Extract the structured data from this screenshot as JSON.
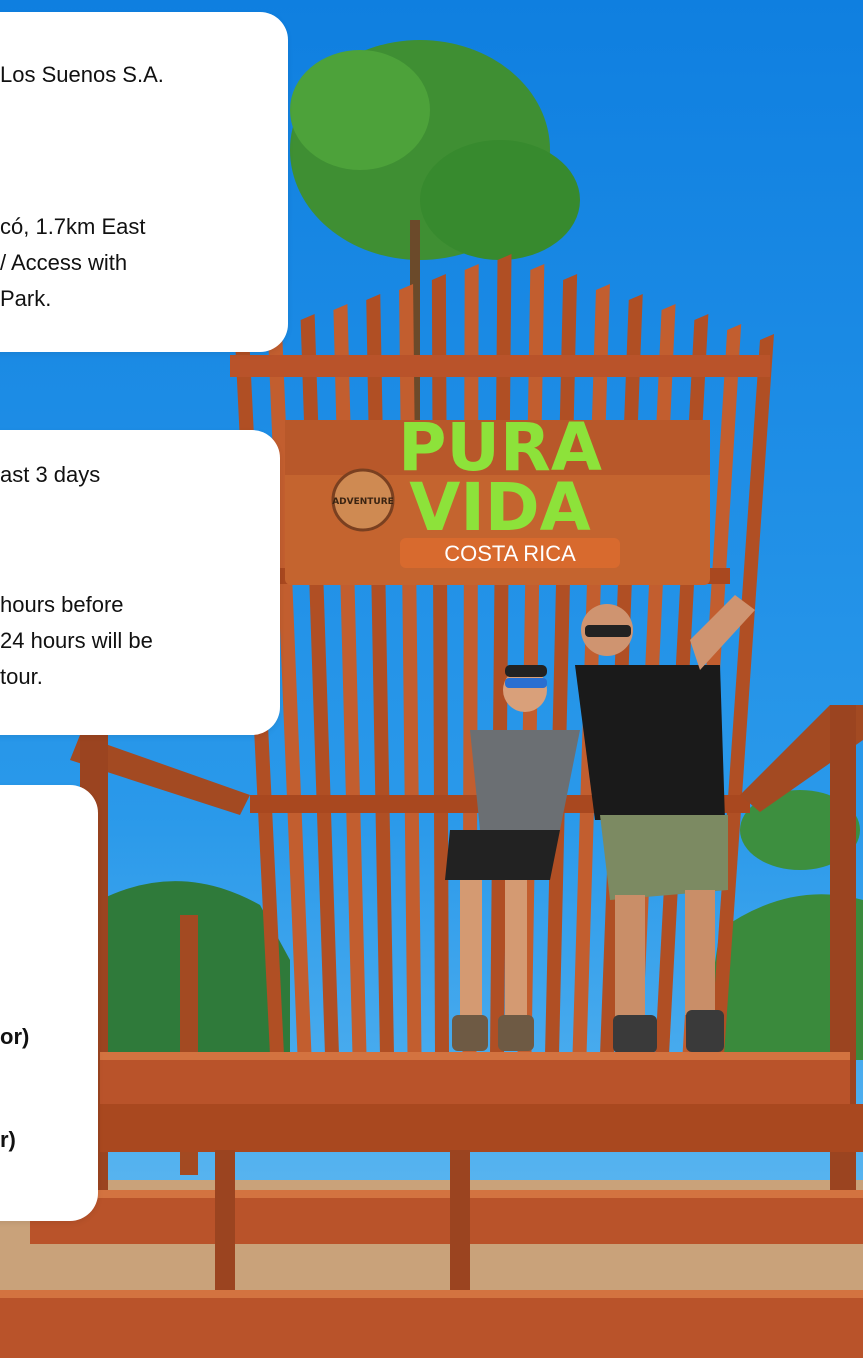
{
  "cards": [
    {
      "lines": [
        "Los Suenos S.A.",
        "có, 1.7km East",
        "/ Access with",
        "Park."
      ]
    },
    {
      "lines": [
        "ast 3 days",
        "hours before",
        "24 hours will be",
        "tour."
      ]
    },
    {
      "lines": [
        "or)",
        "r)"
      ]
    }
  ],
  "photo": {
    "sign": {
      "line1": "PURA",
      "line2": "VIDA",
      "line3": "COSTA RICA",
      "badge": "ADVENTURE"
    }
  },
  "colors": {
    "sky": "#1f8fe6",
    "wood": "#b9532a",
    "woodDark": "#8e3a18",
    "signGreen": "#8de23a",
    "card": "#ffffff"
  }
}
